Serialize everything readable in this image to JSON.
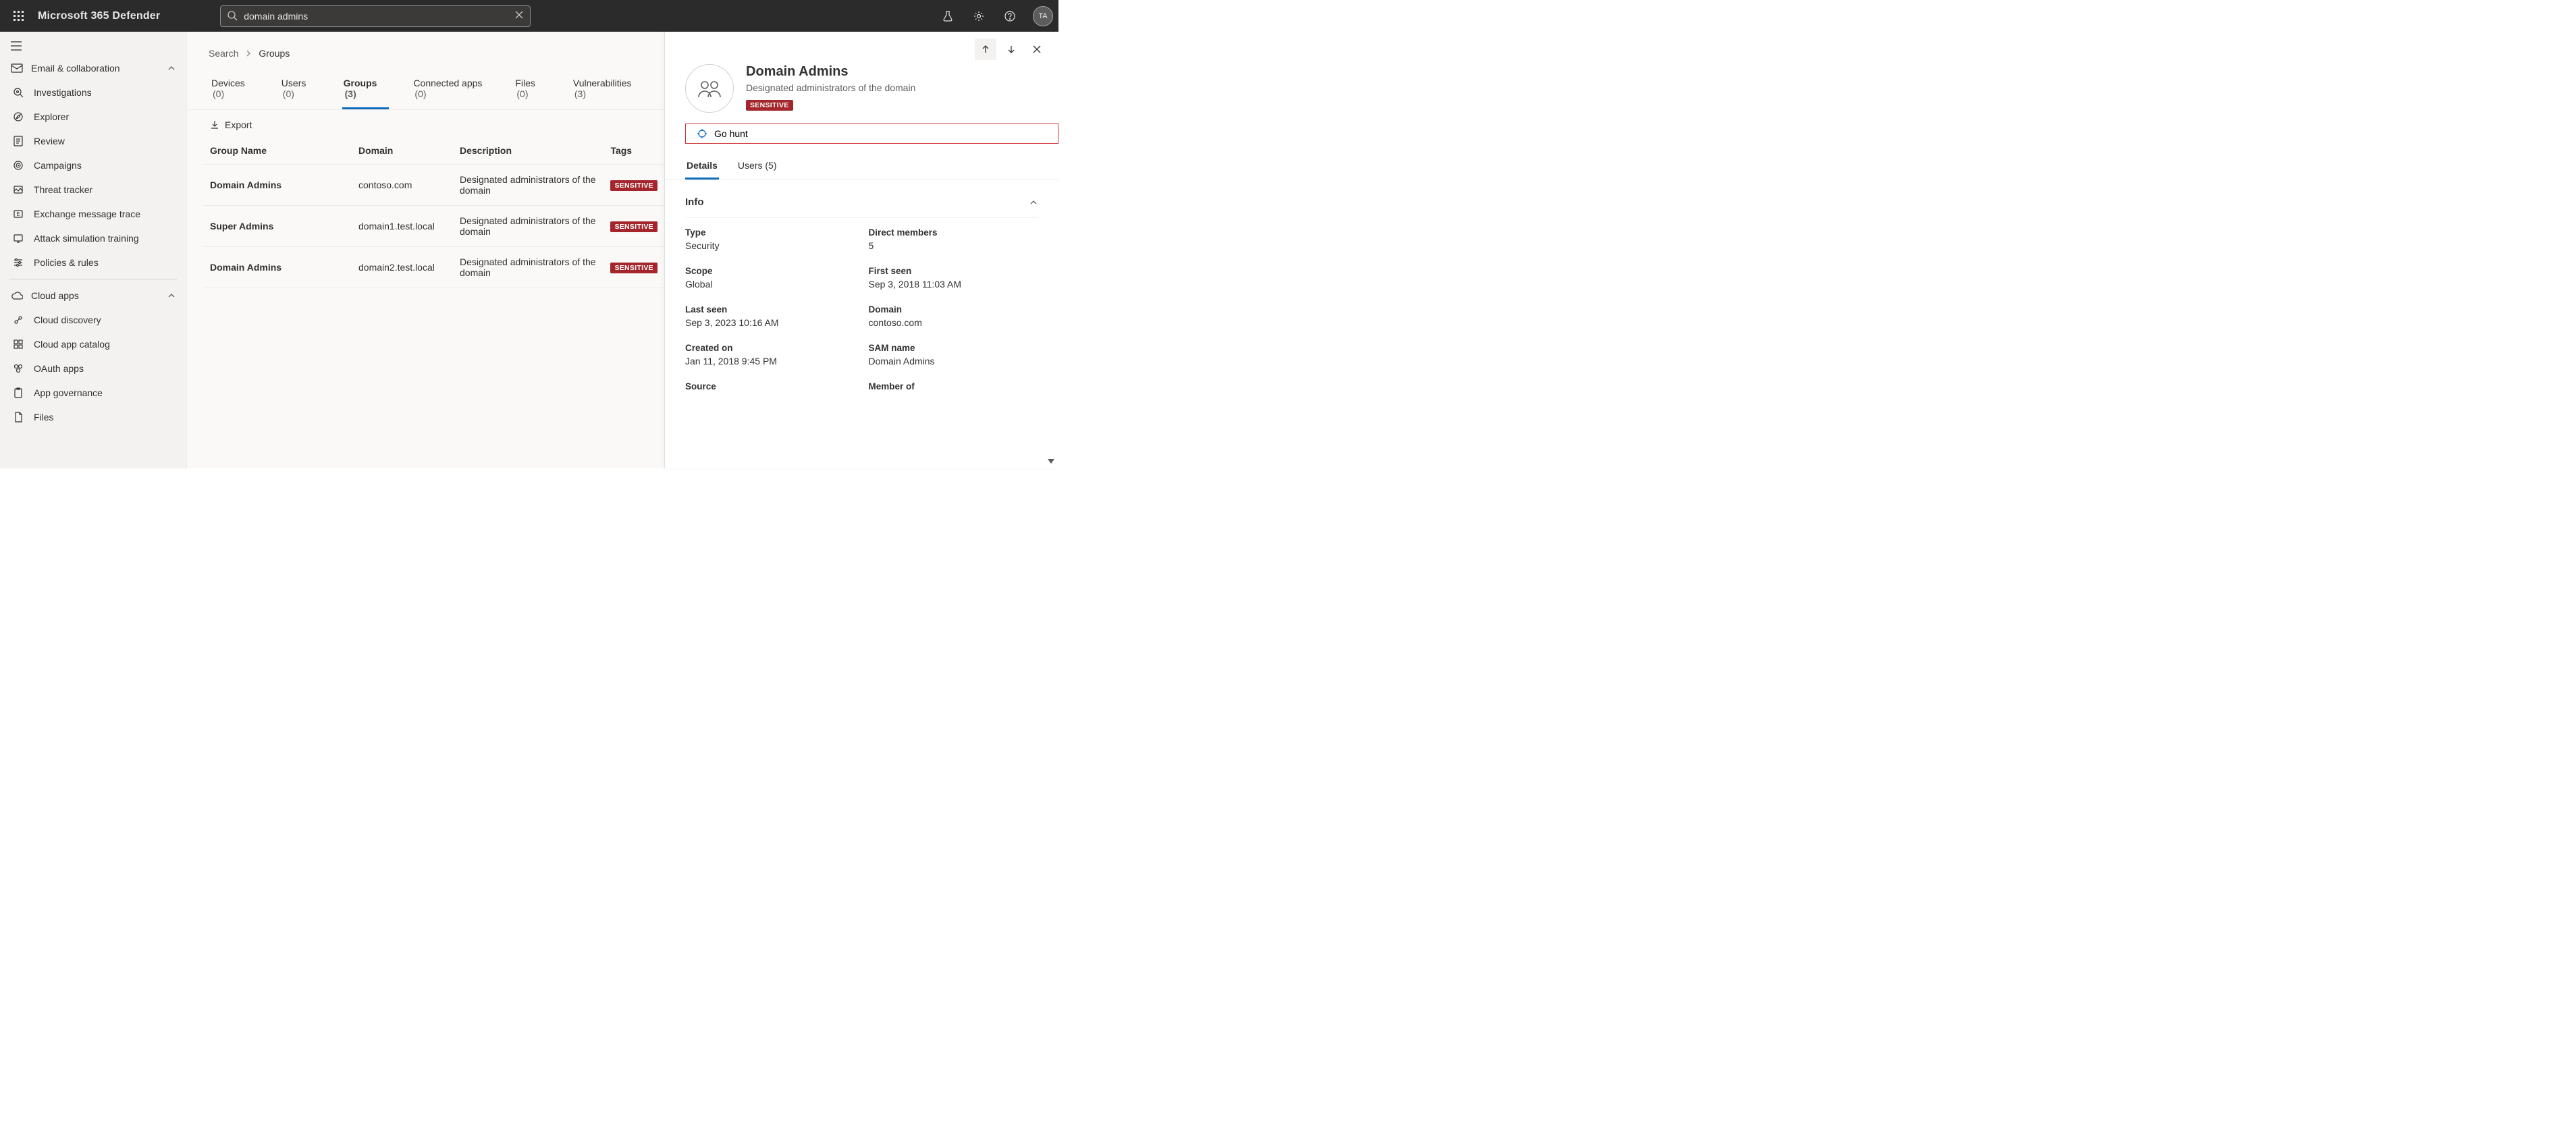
{
  "header": {
    "app_title": "Microsoft 365 Defender",
    "search_value": "domain admins",
    "avatar_initials": "TA"
  },
  "sidebar": {
    "section1": {
      "title": "Email & collaboration"
    },
    "items1": [
      {
        "label": "Investigations"
      },
      {
        "label": "Explorer"
      },
      {
        "label": "Review"
      },
      {
        "label": "Campaigns"
      },
      {
        "label": "Threat tracker"
      },
      {
        "label": "Exchange message trace"
      },
      {
        "label": "Attack simulation training"
      },
      {
        "label": "Policies & rules"
      }
    ],
    "section2": {
      "title": "Cloud apps"
    },
    "items2": [
      {
        "label": "Cloud discovery"
      },
      {
        "label": "Cloud app catalog"
      },
      {
        "label": "OAuth apps"
      },
      {
        "label": "App governance"
      },
      {
        "label": "Files"
      }
    ]
  },
  "breadcrumbs": {
    "root": "Search",
    "current": "Groups"
  },
  "tabs": [
    {
      "label": "Devices",
      "count": "(0)"
    },
    {
      "label": "Users",
      "count": "(0)"
    },
    {
      "label": "Groups",
      "count": "(3)"
    },
    {
      "label": "Connected apps",
      "count": "(0)"
    },
    {
      "label": "Files",
      "count": "(0)"
    },
    {
      "label": "Vulnerabilities",
      "count": "(3)"
    }
  ],
  "toolbar": {
    "export": "Export"
  },
  "table": {
    "headers": {
      "name": "Group Name",
      "domain": "Domain",
      "desc": "Description",
      "tags": "Tags"
    },
    "rows": [
      {
        "name": "Domain Admins",
        "domain": "contoso.com",
        "desc": "Designated administrators of the domain",
        "tag": "SENSITIVE"
      },
      {
        "name": "Super Admins",
        "domain": "domain1.test.local",
        "desc": "Designated administrators of the domain",
        "tag": "SENSITIVE"
      },
      {
        "name": "Domain Admins",
        "domain": "domain2.test.local",
        "desc": "Designated administrators of the domain",
        "tag": "SENSITIVE"
      }
    ]
  },
  "panel": {
    "title": "Domain Admins",
    "subtitle": "Designated administrators of the domain",
    "badge": "SENSITIVE",
    "go_hunt": "Go hunt",
    "tabs": {
      "details": "Details",
      "users": "Users (5)"
    },
    "section_info": "Info",
    "fields": {
      "type_l": "Type",
      "type_v": "Security",
      "direct_l": "Direct members",
      "direct_v": "5",
      "scope_l": "Scope",
      "scope_v": "Global",
      "first_l": "First seen",
      "first_v": "Sep 3, 2018 11:03 AM",
      "last_l": "Last seen",
      "last_v": "Sep 3, 2023 10:16 AM",
      "domain_l": "Domain",
      "domain_v": "contoso.com",
      "created_l": "Created on",
      "created_v": "Jan 11, 2018 9:45 PM",
      "sam_l": "SAM name",
      "sam_v": "Domain Admins",
      "source_l": "Source",
      "member_l": "Member of"
    }
  }
}
